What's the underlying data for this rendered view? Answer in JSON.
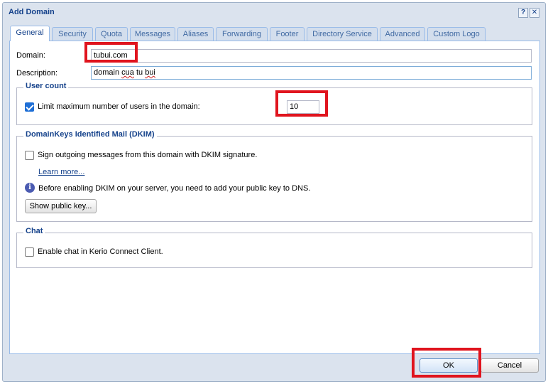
{
  "window": {
    "title": "Add Domain",
    "help_label": "?",
    "close_label": "✕"
  },
  "tabs": [
    {
      "label": "General",
      "active": true
    },
    {
      "label": "Security"
    },
    {
      "label": "Quota"
    },
    {
      "label": "Messages"
    },
    {
      "label": "Aliases"
    },
    {
      "label": "Forwarding"
    },
    {
      "label": "Footer"
    },
    {
      "label": "Directory Service"
    },
    {
      "label": "Advanced"
    },
    {
      "label": "Custom Logo"
    }
  ],
  "general": {
    "domain_label": "Domain:",
    "domain_value": "tubui.com",
    "description_label": "Description:",
    "description_value_plain": "domain ",
    "description_value_spell": "cua",
    "description_value_mid": " tu ",
    "description_value_spell2": "bui"
  },
  "user_count": {
    "legend": "User count",
    "limit_label": "Limit maximum number of users in the domain:",
    "limit_checked": true,
    "limit_value": "10"
  },
  "dkim": {
    "legend": "DomainKeys Identified Mail (DKIM)",
    "sign_label": "Sign outgoing messages from this domain with DKIM signature.",
    "sign_checked": false,
    "learn_more": "Learn more...",
    "info_text": "Before enabling DKIM on your server, you need to add your public key to DNS.",
    "show_key_button": "Show public key..."
  },
  "chat": {
    "legend": "Chat",
    "enable_label": "Enable chat in Kerio Connect Client.",
    "enable_checked": false
  },
  "footer": {
    "ok_label": "OK",
    "cancel_label": "Cancel"
  },
  "colors": {
    "highlight": "#e0141e",
    "accent": "#15428b",
    "checkbox_checked": "#1f6fd6"
  }
}
